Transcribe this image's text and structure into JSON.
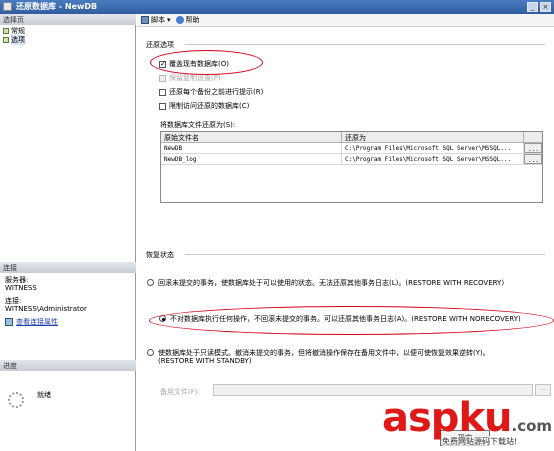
{
  "window": {
    "title": "还原数据库 - NewDB"
  },
  "left": {
    "select_page_header": "选择页",
    "pages": [
      {
        "label": "常规",
        "selected": false
      },
      {
        "label": "选项",
        "selected": true
      }
    ],
    "connection_header": "连接",
    "server_label": "服务器:",
    "server_value": "WITNESS",
    "connection_label": "连接:",
    "connection_value": "WITNESS\\Administrator",
    "view_connection_link": "查看连接属性",
    "progress_header": "进度",
    "progress_status": "就绪"
  },
  "toolbar": {
    "script_label": "脚本",
    "help_label": "帮助"
  },
  "restore_options": {
    "title": "还原选项",
    "overwrite": {
      "label": "覆盖现有数据库(O)",
      "checked": true
    },
    "keep_replication": {
      "label": "保留复制设置(P)",
      "checked": false
    },
    "prompt_before_each": {
      "label": "还原每个备份之前进行提示(R)",
      "checked": false
    },
    "restrict_access": {
      "label": "限制访问还原的数据库(C)",
      "checked": false
    },
    "file_grid_caption": "将数据库文件还原为(S):",
    "columns": [
      "原始文件名",
      "还原为"
    ],
    "rows": [
      {
        "original": "NewDB",
        "restore_as": "C:\\Program Files\\Microsoft SQL Server\\MSSQL..."
      },
      {
        "original": "NewDB_log",
        "restore_as": "C:\\Program Files\\Microsoft SQL Server\\MSSQL..."
      }
    ],
    "browse_label": "..."
  },
  "recovery_state": {
    "title": "恢复状态",
    "options": [
      {
        "label": "回滚未提交的事务，使数据库处于可以使用的状态。无法还原其他事务日志(L)。(RESTORE WITH RECOVERY)",
        "selected": false
      },
      {
        "label": "不对数据库执行任何操作，不回滚未提交的事务。可以还原其他事务日志(A)。(RESTORE WITH NORECOVERY)",
        "selected": true
      },
      {
        "label": "使数据库处于只读模式。撤消未提交的事务，但将撤消操作保存在备用文件中，以便可使恢复效果逆转(Y)。(RESTORE WITH STANDBY)",
        "selected": false
      }
    ],
    "standby_file_label": "备用文件(F):",
    "standby_browse_label": "..."
  },
  "footer": {
    "ok_label": "确定"
  },
  "watermark": {
    "logo_asp": "asp",
    "logo_ku": "ku",
    "logo_com": ".com",
    "subtitle": "免费网站源码下载站!"
  },
  "colors": {
    "title_bar": "#2f5d9e",
    "annotation_red": "#d4001a",
    "watermark_red": "#e01818",
    "link": "#1a3fb0"
  }
}
